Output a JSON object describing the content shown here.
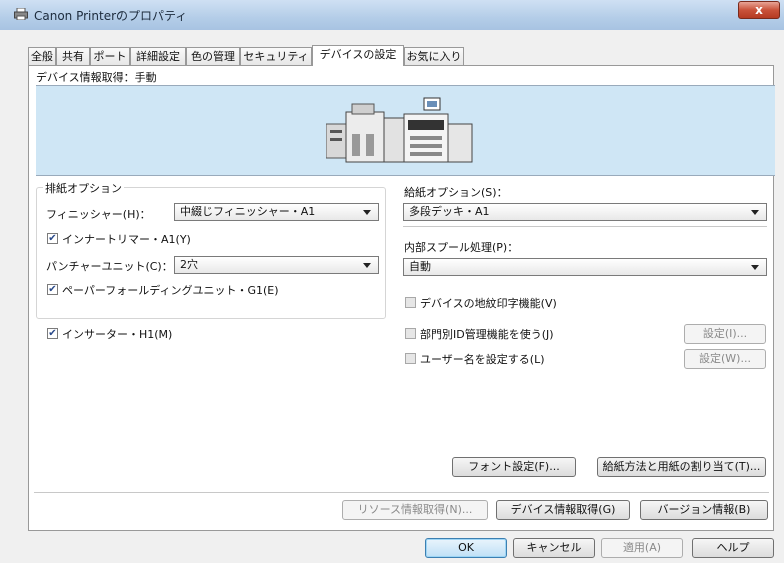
{
  "window": {
    "title": "Canon Printerのプロパティ",
    "close_label": "x"
  },
  "tabs": [
    "全般",
    "共有",
    "ポート",
    "詳細設定",
    "色の管理",
    "セキュリティ",
    "デバイスの設定",
    "お気に入り"
  ],
  "active_tab": "デバイスの設定",
  "device_info": "デバイス情報取得：手動",
  "output_options": {
    "group_label": "排紙オプション",
    "finisher_label": "フィニッシャー(H)：",
    "finisher_value": "中綴じフィニッシャー・A1",
    "inner_trimmer_label": "インナートリマー・A1(Y)",
    "inner_trimmer_checked": true,
    "puncher_label": "パンチャーユニット(C)：",
    "puncher_value": "2穴",
    "paper_folding_label": "ペーパーフォールディングユニット・G1(E)",
    "paper_folding_checked": true
  },
  "inserter": {
    "label": "インサーター・H1(M)",
    "checked": true
  },
  "paper_source": {
    "label": "給紙オプション(S)：",
    "value": "多段デッキ・A1"
  },
  "spool": {
    "label": "内部スプール処理(P)：",
    "value": "自動"
  },
  "watermark": {
    "label": "デバイスの地紋印字機能(V)",
    "checked": false
  },
  "dept_id": {
    "label": "部門別ID管理機能を使う(J)",
    "checked": false,
    "button": "設定(I)..."
  },
  "user_name": {
    "label": "ユーザー名を設定する(L)",
    "checked": false,
    "button": "設定(W)..."
  },
  "buttons": {
    "font_settings": "フォント設定(F)...",
    "paper_assign": "給紙方法と用紙の割り当て(T)...",
    "resource_info": "リソース情報取得(N)...",
    "device_info": "デバイス情報取得(G)",
    "version_info": "バージョン情報(B)"
  },
  "footer": {
    "ok": "OK",
    "cancel": "キャンセル",
    "apply": "適用(A)",
    "help": "ヘルプ"
  }
}
